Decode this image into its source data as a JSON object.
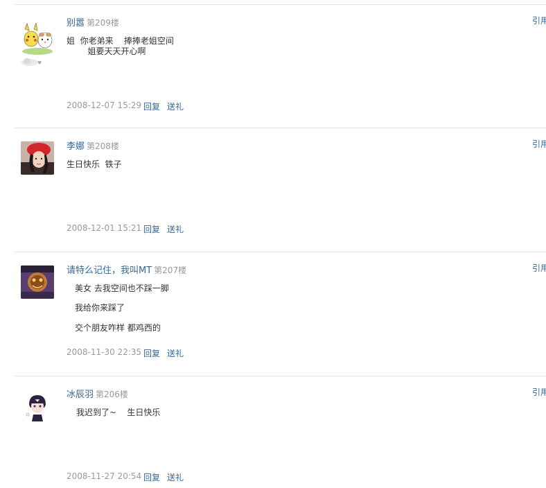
{
  "posts": [
    {
      "username": "别嚣",
      "floor": "第209楼",
      "lines": [
        "姐  你老弟来    捧捧老姐空间",
        "        姐要天天开心啊"
      ],
      "timestamp": "2008-12-07 15:29",
      "reply_label": "回复",
      "gift_label": "送礼",
      "quote_label": "引用"
    },
    {
      "username": "李娜",
      "floor": "第208楼",
      "lines": [
        "生日快乐  铁子"
      ],
      "timestamp": "2008-12-01 15:21",
      "reply_label": "回复",
      "gift_label": "送礼",
      "quote_label": "引用"
    },
    {
      "username": "请特么记住，我叫MT",
      "floor": "第207楼",
      "lines": [
        "美女 去我空间也不踩一脚",
        "我给你来踩了",
        "交个朋友咋样 都鸡西的"
      ],
      "timestamp": "2008-11-30 22:35",
      "reply_label": "回复",
      "gift_label": "送礼",
      "quote_label": "引用"
    },
    {
      "username": "冰辰羽",
      "floor": "第206楼",
      "lines": [
        "我迟到了~    生日快乐"
      ],
      "timestamp": "2008-11-27 20:54",
      "reply_label": "回复",
      "gift_label": "送礼",
      "quote_label": "引用"
    }
  ],
  "avatars": [
    "pikachu-hamster-avatar",
    "red-hat-girl-avatar",
    "character-avatar",
    "anime-boy-avatar"
  ]
}
